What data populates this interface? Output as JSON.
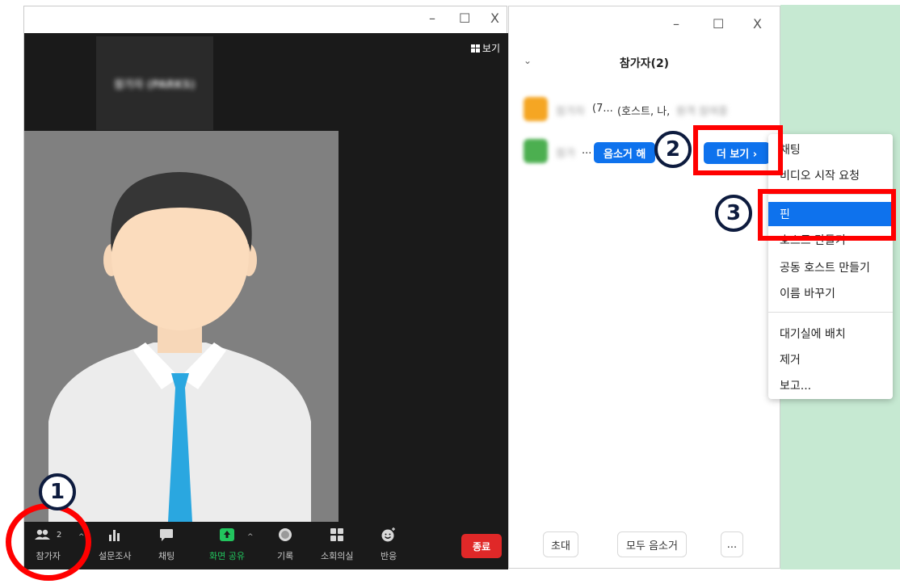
{
  "zoom_window": {
    "title_controls": [
      "–",
      "☐",
      "X"
    ],
    "view_button_label": "보기",
    "thumbnail_name": "참가자 (PARKS)",
    "toolbar": {
      "participants_label": "참가자",
      "participants_count": "2",
      "poll_label": "설문조사",
      "chat_label": "채팅",
      "share_label": "화면 공유",
      "record_label": "기록",
      "breakout_label": "소회의실",
      "reactions_label": "반응",
      "end_label": "종료"
    },
    "colors": {
      "share_green": "#22c55e",
      "end_red": "#e02828"
    }
  },
  "participants_panel": {
    "title_controls": [
      "–",
      "☐",
      "X"
    ],
    "title": "참가자(2)",
    "rows": [
      {
        "name_prefix": "(7...",
        "role": "(호스트, 나,",
        "name_blurred": "참가자",
        "name_tail": "원격 참여중"
      },
      {
        "name_blurred": "참가",
        "ellipsis": "...",
        "mute_label": "음소거 해",
        "more_label": "더 보기 ›"
      }
    ],
    "footer": {
      "invite_label": "초대",
      "mute_all_label": "모두 음소거",
      "more_label": "..."
    },
    "accent_color": "#0e72ed"
  },
  "context_menu": {
    "items": [
      {
        "label": "채팅"
      },
      {
        "label": "비디오 시작 요청"
      },
      {
        "label": "핀",
        "selected": true
      },
      {
        "label": "호스트 만들기"
      },
      {
        "label": "공동 호스트 만들기"
      },
      {
        "label": "이름 바꾸기"
      },
      {
        "label": "대기실에 배치"
      },
      {
        "label": "제거"
      },
      {
        "label": "보고..."
      }
    ]
  },
  "annotations": {
    "step1": "1",
    "step2": "2",
    "step3": "3",
    "highlight_color": "#ff0000"
  }
}
